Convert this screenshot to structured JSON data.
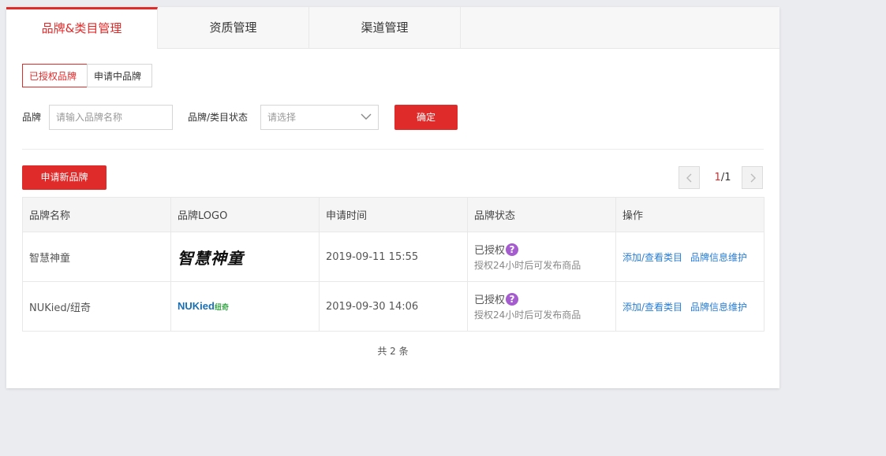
{
  "tabs": [
    {
      "label": "品牌&类目管理"
    },
    {
      "label": "资质管理"
    },
    {
      "label": "渠道管理"
    }
  ],
  "segment": {
    "authorized": "已授权品牌",
    "applying": "申请中品牌"
  },
  "filters": {
    "brand_label": "品牌",
    "brand_placeholder": "请输入品牌名称",
    "status_label": "品牌/类目状态",
    "status_placeholder": "请选择",
    "confirm": "确定"
  },
  "apply_button": "申请新品牌",
  "pager": {
    "current": "1",
    "total": "/1"
  },
  "table": {
    "headers": [
      "品牌名称",
      "品牌LOGO",
      "申请时间",
      "品牌状态",
      "操作"
    ],
    "rows": [
      {
        "name": "智慧神童",
        "logo_text": "智慧神童",
        "time": "2019-09-11 15:55",
        "status": "已授权",
        "status_note": "授权24小时后可发布商品",
        "action1": "添加/查看类目",
        "action2": "品牌信息维护"
      },
      {
        "name": "NUKied/纽奇",
        "logo_text": "NUKied",
        "logo_sub": "纽奇",
        "time": "2019-09-30 14:06",
        "status": "已授权",
        "status_note": "授权24小时后可发布商品",
        "action1": "添加/查看类目",
        "action2": "品牌信息维护"
      }
    ]
  },
  "total": "共 2 条",
  "colors": {
    "accent": "#e02b2b",
    "link": "#2a7ed6",
    "help": "#a45ccf"
  }
}
